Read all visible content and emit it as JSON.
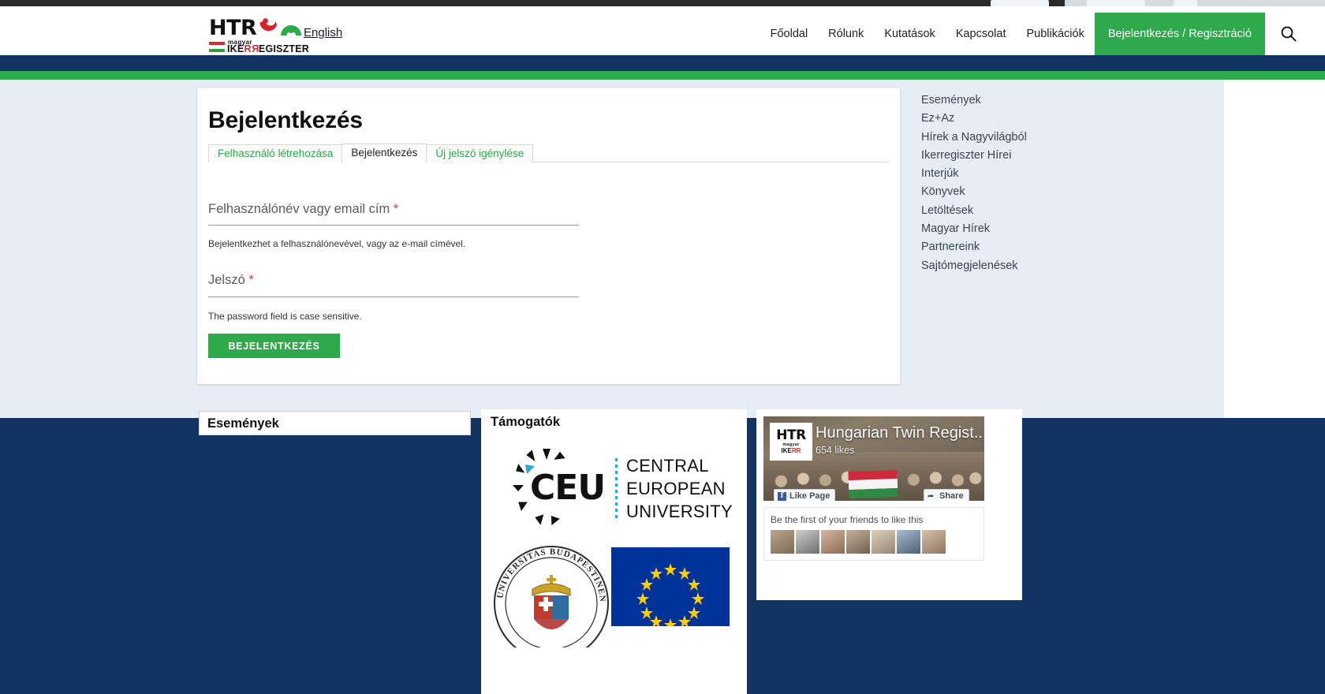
{
  "header": {
    "logo": {
      "main": "HTR",
      "magyar": "magyar",
      "register": "IKERREGISZTER"
    },
    "language_link": "English",
    "nav": [
      {
        "label": "Főoldal",
        "cta": false
      },
      {
        "label": "Rólunk",
        "cta": false
      },
      {
        "label": "Kutatások",
        "cta": false
      },
      {
        "label": "Kapcsolat",
        "cta": false
      },
      {
        "label": "Publikációk",
        "cta": false
      },
      {
        "label": "Bejelentkezés / Regisztráció",
        "cta": true
      }
    ],
    "search_icon": "search-icon"
  },
  "login_card": {
    "title": "Bejelentkezés",
    "tabs": [
      {
        "label": "Felhasználó létrehozása",
        "active": false
      },
      {
        "label": "Bejelentkezés",
        "active": true
      },
      {
        "label": "Új jelszó igénylése",
        "active": false
      }
    ],
    "username": {
      "label": "Felhasználónév vagy email cím",
      "required_marker": "*",
      "value": "",
      "help": "Bejelentkezhet a felhasználónevével, vagy az e-mail címével."
    },
    "password": {
      "label": "Jelszó",
      "required_marker": "*",
      "value": "",
      "help": "The password field is case sensitive."
    },
    "submit_label": "BEJELENTKEZÉS"
  },
  "sidebar": {
    "items": [
      {
        "label": "Események"
      },
      {
        "label": "Ez+Az"
      },
      {
        "label": "Hírek a Nagyvilágból"
      },
      {
        "label": "Ikerregiszter Hírei"
      },
      {
        "label": "Interjúk"
      },
      {
        "label": "Könyvek"
      },
      {
        "label": "Letöltések"
      },
      {
        "label": "Magyar Hírek"
      },
      {
        "label": "Partnereink"
      },
      {
        "label": "Sajtómegjelenések"
      }
    ]
  },
  "footer": {
    "events_title": "Események",
    "supporters_title": "Támogatók",
    "ceu": {
      "abbr": "CEU",
      "line1": "CENTRAL",
      "line2": "EUROPEAN",
      "line3": "UNIVERSITY"
    },
    "semmelweis_motto": "UNIVERSITAS BUDAPESTINENSIS DE SEMMELWEIS NOM",
    "facebook": {
      "page_name": "Hungarian Twin Regist...",
      "likes": "654 likes",
      "like_button": "Like Page",
      "share_button": "Share",
      "friends_text": "Be the first of your friends to like this",
      "logo_main": "HTR",
      "logo_magyar": "magyar",
      "logo_ikerr": "IKERR"
    }
  },
  "colors": {
    "brand_green": "#2ea94c",
    "brand_navy": "#123462",
    "page_bg": "#e7edf5",
    "required_red": "#d94040"
  }
}
